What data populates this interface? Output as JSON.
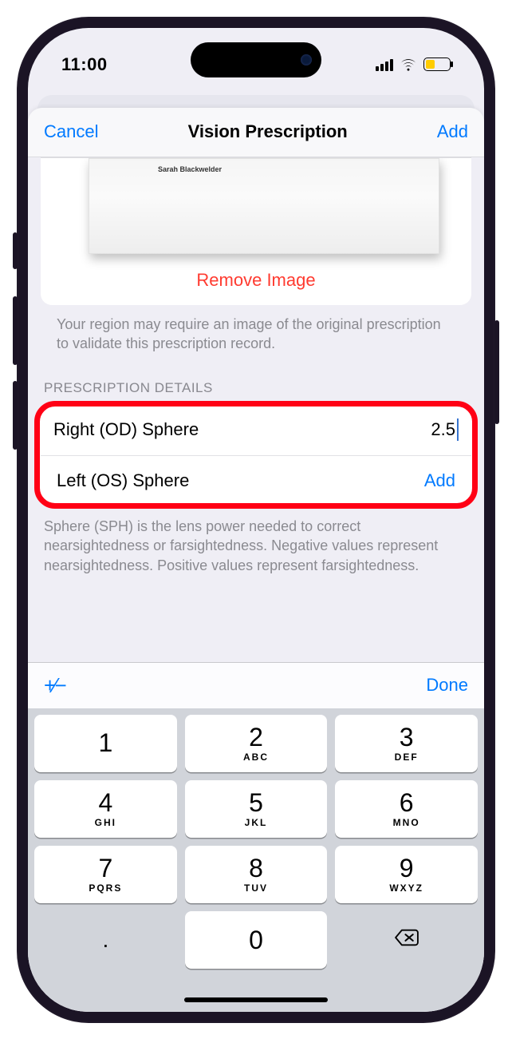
{
  "status": {
    "time": "11:00"
  },
  "nav": {
    "cancel": "Cancel",
    "title": "Vision Prescription",
    "add": "Add"
  },
  "image_card": {
    "doc_name": "Sarah Blackwelder",
    "remove": "Remove Image",
    "footnote": "Your region may require an image of the original prescription to validate this prescription record."
  },
  "details": {
    "header": "PRESCRIPTION DETAILS",
    "rows": [
      {
        "label": "Right (OD) Sphere",
        "value": "2.5",
        "editing": true
      },
      {
        "label": "Left (OS) Sphere",
        "value": "Add",
        "is_link": true
      }
    ],
    "footnote": "Sphere (SPH) is the lens power needed to correct nearsightedness or farsightedness. Negative values represent nearsightedness. Positive values represent farsightedness."
  },
  "keyboard": {
    "plus_minus": "+⁄−",
    "done": "Done",
    "keys": [
      [
        {
          "d": "1",
          "l": ""
        },
        {
          "d": "2",
          "l": "ABC"
        },
        {
          "d": "3",
          "l": "DEF"
        }
      ],
      [
        {
          "d": "4",
          "l": "GHI"
        },
        {
          "d": "5",
          "l": "JKL"
        },
        {
          "d": "6",
          "l": "MNO"
        }
      ],
      [
        {
          "d": "7",
          "l": "PQRS"
        },
        {
          "d": "8",
          "l": "TUV"
        },
        {
          "d": "9",
          "l": "WXYZ"
        }
      ]
    ],
    "dot": ".",
    "zero": "0"
  }
}
